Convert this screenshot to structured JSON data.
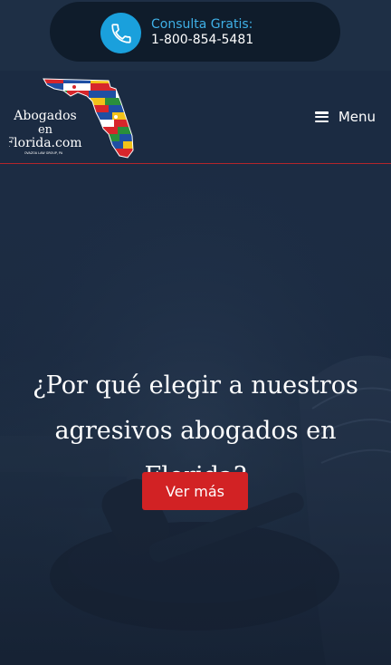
{
  "topbar": {
    "call_label": "Consulta Gratis:",
    "phone_number": "1-800-854-5481",
    "icon": "phone-icon",
    "accent_color": "#1aa0dc"
  },
  "header": {
    "logo": {
      "line1": "Abogados",
      "line2": "en",
      "line3": "Florida.com",
      "tagline": "OVAZOA LAW GROUP, PA"
    },
    "menu_label": "Menu"
  },
  "hero": {
    "title_line1": "¿Por qué elegir a nuestros",
    "title_line2": "agresivos abogados en Florida?",
    "cta_label": "Ver más",
    "cta_color": "#d22224"
  }
}
